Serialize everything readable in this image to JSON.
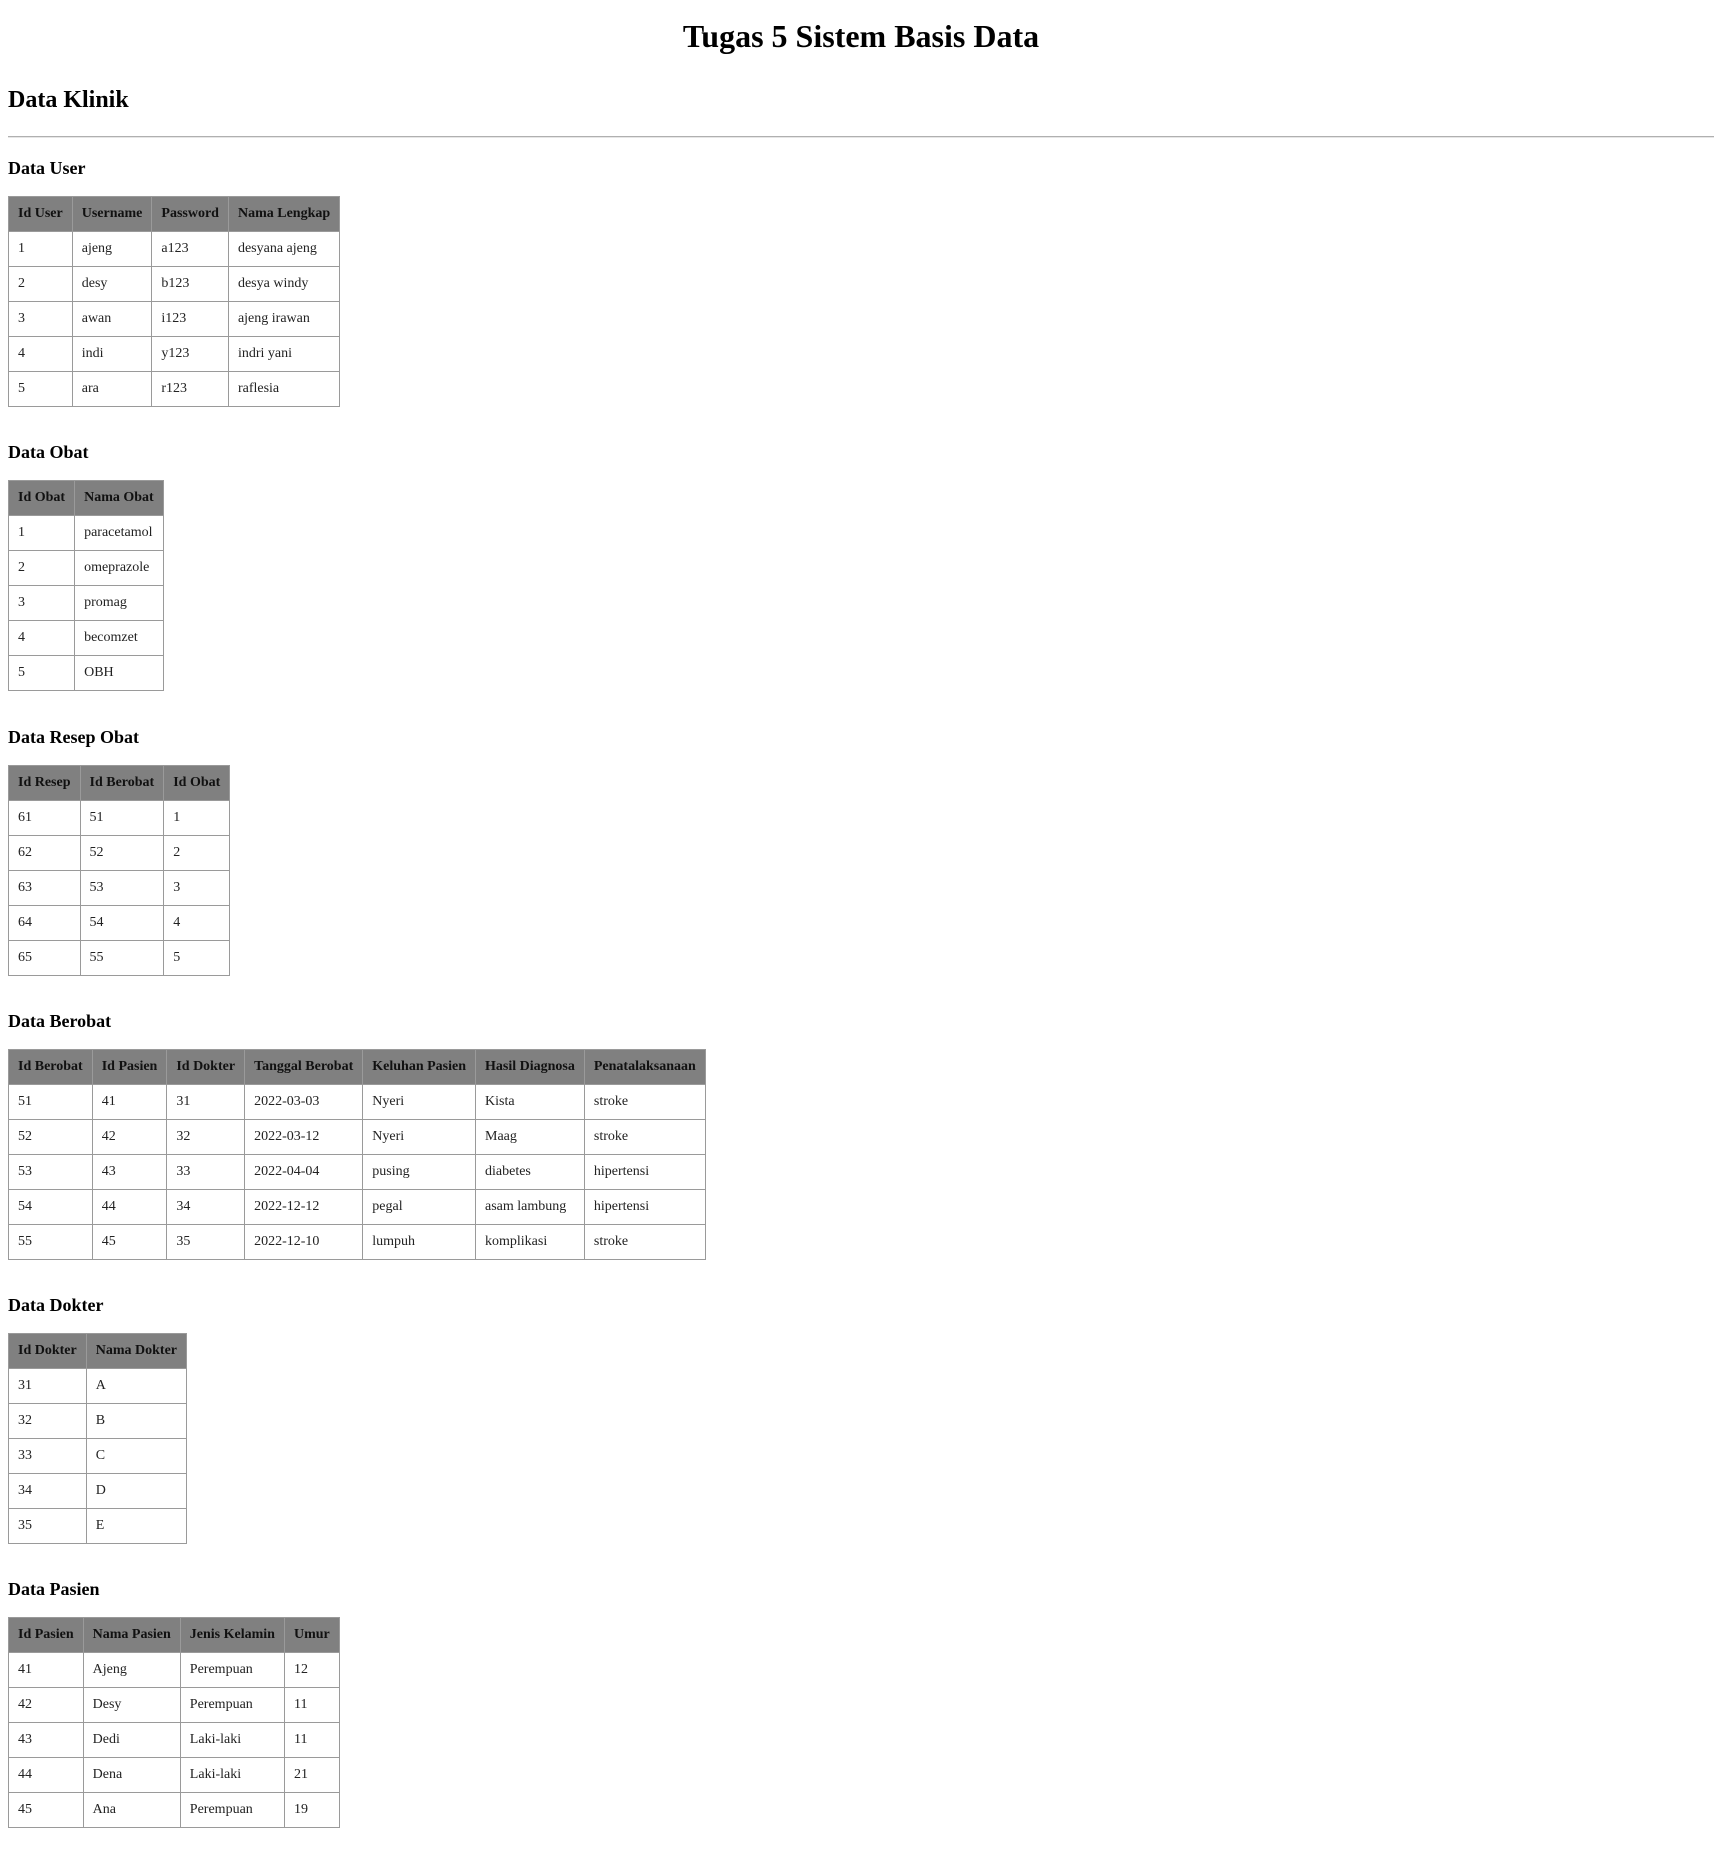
{
  "page": {
    "title": "Tugas 5 Sistem Basis Data",
    "subtitle": "Data Klinik"
  },
  "tables": {
    "user": {
      "title": "Data User",
      "columns": [
        "Id User",
        "Username",
        "Password",
        "Nama Lengkap"
      ],
      "rows": [
        [
          "1",
          "ajeng",
          "a123",
          "desyana ajeng"
        ],
        [
          "2",
          "desy",
          "b123",
          "desya windy"
        ],
        [
          "3",
          "awan",
          "i123",
          "ajeng irawan"
        ],
        [
          "4",
          "indi",
          "y123",
          "indri yani"
        ],
        [
          "5",
          "ara",
          "r123",
          "raflesia"
        ]
      ]
    },
    "obat": {
      "title": "Data Obat",
      "columns": [
        "Id Obat",
        "Nama Obat"
      ],
      "rows": [
        [
          "1",
          "paracetamol"
        ],
        [
          "2",
          "omeprazole"
        ],
        [
          "3",
          "promag"
        ],
        [
          "4",
          "becomzet"
        ],
        [
          "5",
          "OBH"
        ]
      ]
    },
    "resep": {
      "title": "Data Resep Obat",
      "columns": [
        "Id Resep",
        "Id Berobat",
        "Id Obat"
      ],
      "rows": [
        [
          "61",
          "51",
          "1"
        ],
        [
          "62",
          "52",
          "2"
        ],
        [
          "63",
          "53",
          "3"
        ],
        [
          "64",
          "54",
          "4"
        ],
        [
          "65",
          "55",
          "5"
        ]
      ]
    },
    "berobat": {
      "title": "Data Berobat",
      "columns": [
        "Id Berobat",
        "Id Pasien",
        "Id Dokter",
        "Tanggal Berobat",
        "Keluhan Pasien",
        "Hasil Diagnosa",
        "Penatalaksanaan"
      ],
      "rows": [
        [
          "51",
          "41",
          "31",
          "2022-03-03",
          "Nyeri",
          "Kista",
          "stroke"
        ],
        [
          "52",
          "42",
          "32",
          "2022-03-12",
          "Nyeri",
          "Maag",
          "stroke"
        ],
        [
          "53",
          "43",
          "33",
          "2022-04-04",
          "pusing",
          "diabetes",
          "hipertensi"
        ],
        [
          "54",
          "44",
          "34",
          "2022-12-12",
          "pegal",
          "asam lambung",
          "hipertensi"
        ],
        [
          "55",
          "45",
          "35",
          "2022-12-10",
          "lumpuh",
          "komplikasi",
          "stroke"
        ]
      ]
    },
    "dokter": {
      "title": "Data Dokter",
      "columns": [
        "Id Dokter",
        "Nama Dokter"
      ],
      "rows": [
        [
          "31",
          "A"
        ],
        [
          "32",
          "B"
        ],
        [
          "33",
          "C"
        ],
        [
          "34",
          "D"
        ],
        [
          "35",
          "E"
        ]
      ]
    },
    "pasien": {
      "title": "Data Pasien",
      "columns": [
        "Id Pasien",
        "Nama Pasien",
        "Jenis Kelamin",
        "Umur"
      ],
      "rows": [
        [
          "41",
          "Ajeng",
          "Perempuan",
          "12"
        ],
        [
          "42",
          "Desy",
          "Perempuan",
          "11"
        ],
        [
          "43",
          "Dedi",
          "Laki-laki",
          "11"
        ],
        [
          "44",
          "Dena",
          "Laki-laki",
          "21"
        ],
        [
          "45",
          "Ana",
          "Perempuan",
          "19"
        ]
      ]
    }
  },
  "colors": {
    "header_bg": "#808080",
    "border": "#9a9a9a"
  }
}
